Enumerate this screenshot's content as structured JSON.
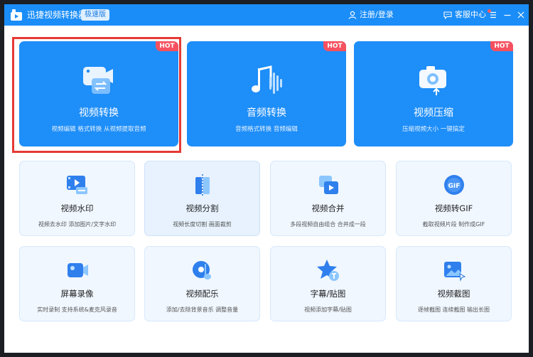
{
  "app": {
    "title": "迅捷视频转换器",
    "edition": "极速版",
    "login_label": "注册/登录",
    "service_label": "客服中心"
  },
  "colors": {
    "titlebar": "#1a8df8",
    "feature_card": "#1e8ef8",
    "hot_badge": "#f5515f",
    "tool_card": "#f0f7ff",
    "highlight": "#e53935"
  },
  "featured": [
    {
      "title": "视频转换",
      "desc": "视频编辑 格式转换 从视频提取音频",
      "badge": "HOT",
      "icon": "video-convert-icon"
    },
    {
      "title": "音频转换",
      "desc": "音频格式转换 音频编辑",
      "badge": "HOT",
      "icon": "audio-convert-icon"
    },
    {
      "title": "视频压缩",
      "desc": "压缩视频大小 一键搞定",
      "badge": "HOT",
      "icon": "video-compress-icon"
    }
  ],
  "tools": [
    {
      "title": "视频水印",
      "desc": "视频去水印 添加图片/文字水印",
      "icon": "watermark-icon"
    },
    {
      "title": "视频分割",
      "desc": "视频长度切割 画面裁剪",
      "icon": "split-icon"
    },
    {
      "title": "视频合并",
      "desc": "多段视频自由组合 合并成一段",
      "icon": "merge-icon"
    },
    {
      "title": "视频转GIF",
      "desc": "截取视频片段 制作成GIF",
      "icon": "gif-icon"
    },
    {
      "title": "屏幕录像",
      "desc": "实时录制 支持系统&麦克风录音",
      "icon": "screen-record-icon"
    },
    {
      "title": "视频配乐",
      "desc": "添加/去除背景音乐 调整音量",
      "icon": "music-icon"
    },
    {
      "title": "字幕/贴图",
      "desc": "视频添加字幕/贴图",
      "icon": "subtitle-icon"
    },
    {
      "title": "视频截图",
      "desc": "逐帧截图 连续截图 输出长图",
      "icon": "screenshot-icon"
    }
  ]
}
